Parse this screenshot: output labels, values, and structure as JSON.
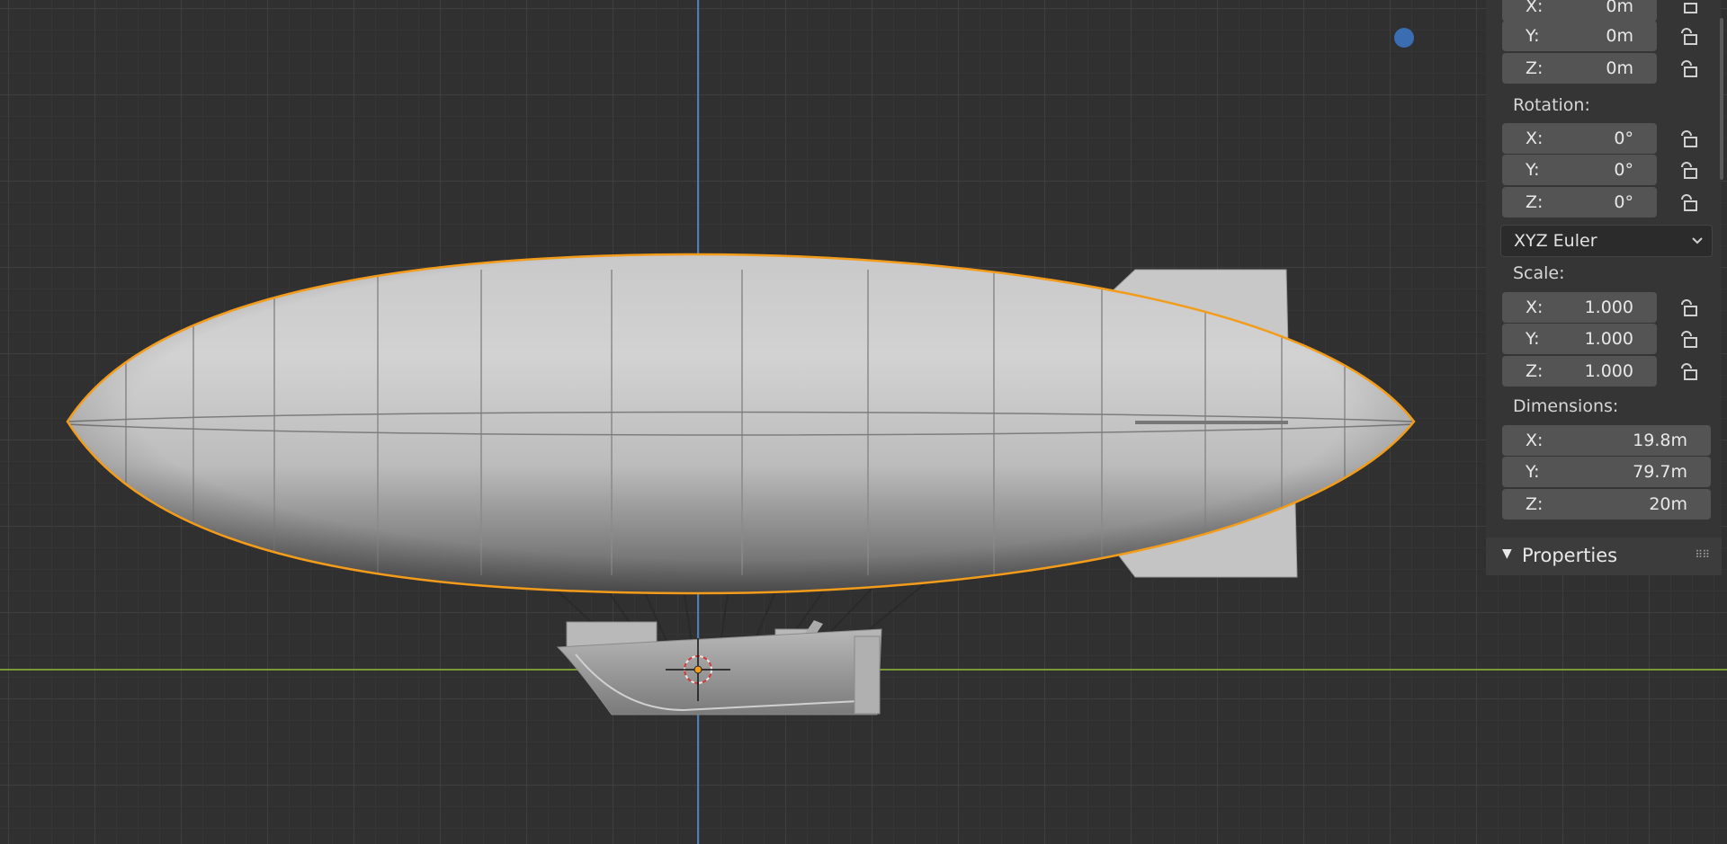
{
  "transform": {
    "location": [
      {
        "axis": "X:",
        "value": "0m"
      },
      {
        "axis": "Y:",
        "value": "0m"
      },
      {
        "axis": "Z:",
        "value": "0m"
      }
    ],
    "rotation_label": "Rotation:",
    "rotation": [
      {
        "axis": "X:",
        "value": "0°"
      },
      {
        "axis": "Y:",
        "value": "0°"
      },
      {
        "axis": "Z:",
        "value": "0°"
      }
    ],
    "rotation_mode": "XYZ Euler",
    "scale_label": "Scale:",
    "scale": [
      {
        "axis": "X:",
        "value": "1.000"
      },
      {
        "axis": "Y:",
        "value": "1.000"
      },
      {
        "axis": "Z:",
        "value": "1.000"
      }
    ],
    "dimensions_label": "Dimensions:",
    "dimensions": [
      {
        "axis": "X:",
        "value": "19.8m"
      },
      {
        "axis": "Y:",
        "value": "79.7m"
      },
      {
        "axis": "Z:",
        "value": "20m"
      }
    ]
  },
  "properties_panel": {
    "title": "Properties"
  },
  "icons": {
    "lock": "lock-open-icon",
    "dropdown": "chevron-down-icon",
    "collapse": "triangle-down-icon",
    "grip": "drag-grip-icon"
  },
  "colors": {
    "viewport_bg": "#303030",
    "grid_minor": "#3a3a3a",
    "grid_major": "#454545",
    "axis_y_green": "#7a9a38",
    "axis_z_blue": "#4a7fbf",
    "selection_outline": "#f39c1b",
    "nav_dot": "#3b6db3",
    "panel_bg": "#353535",
    "field_bg": "#545454"
  }
}
